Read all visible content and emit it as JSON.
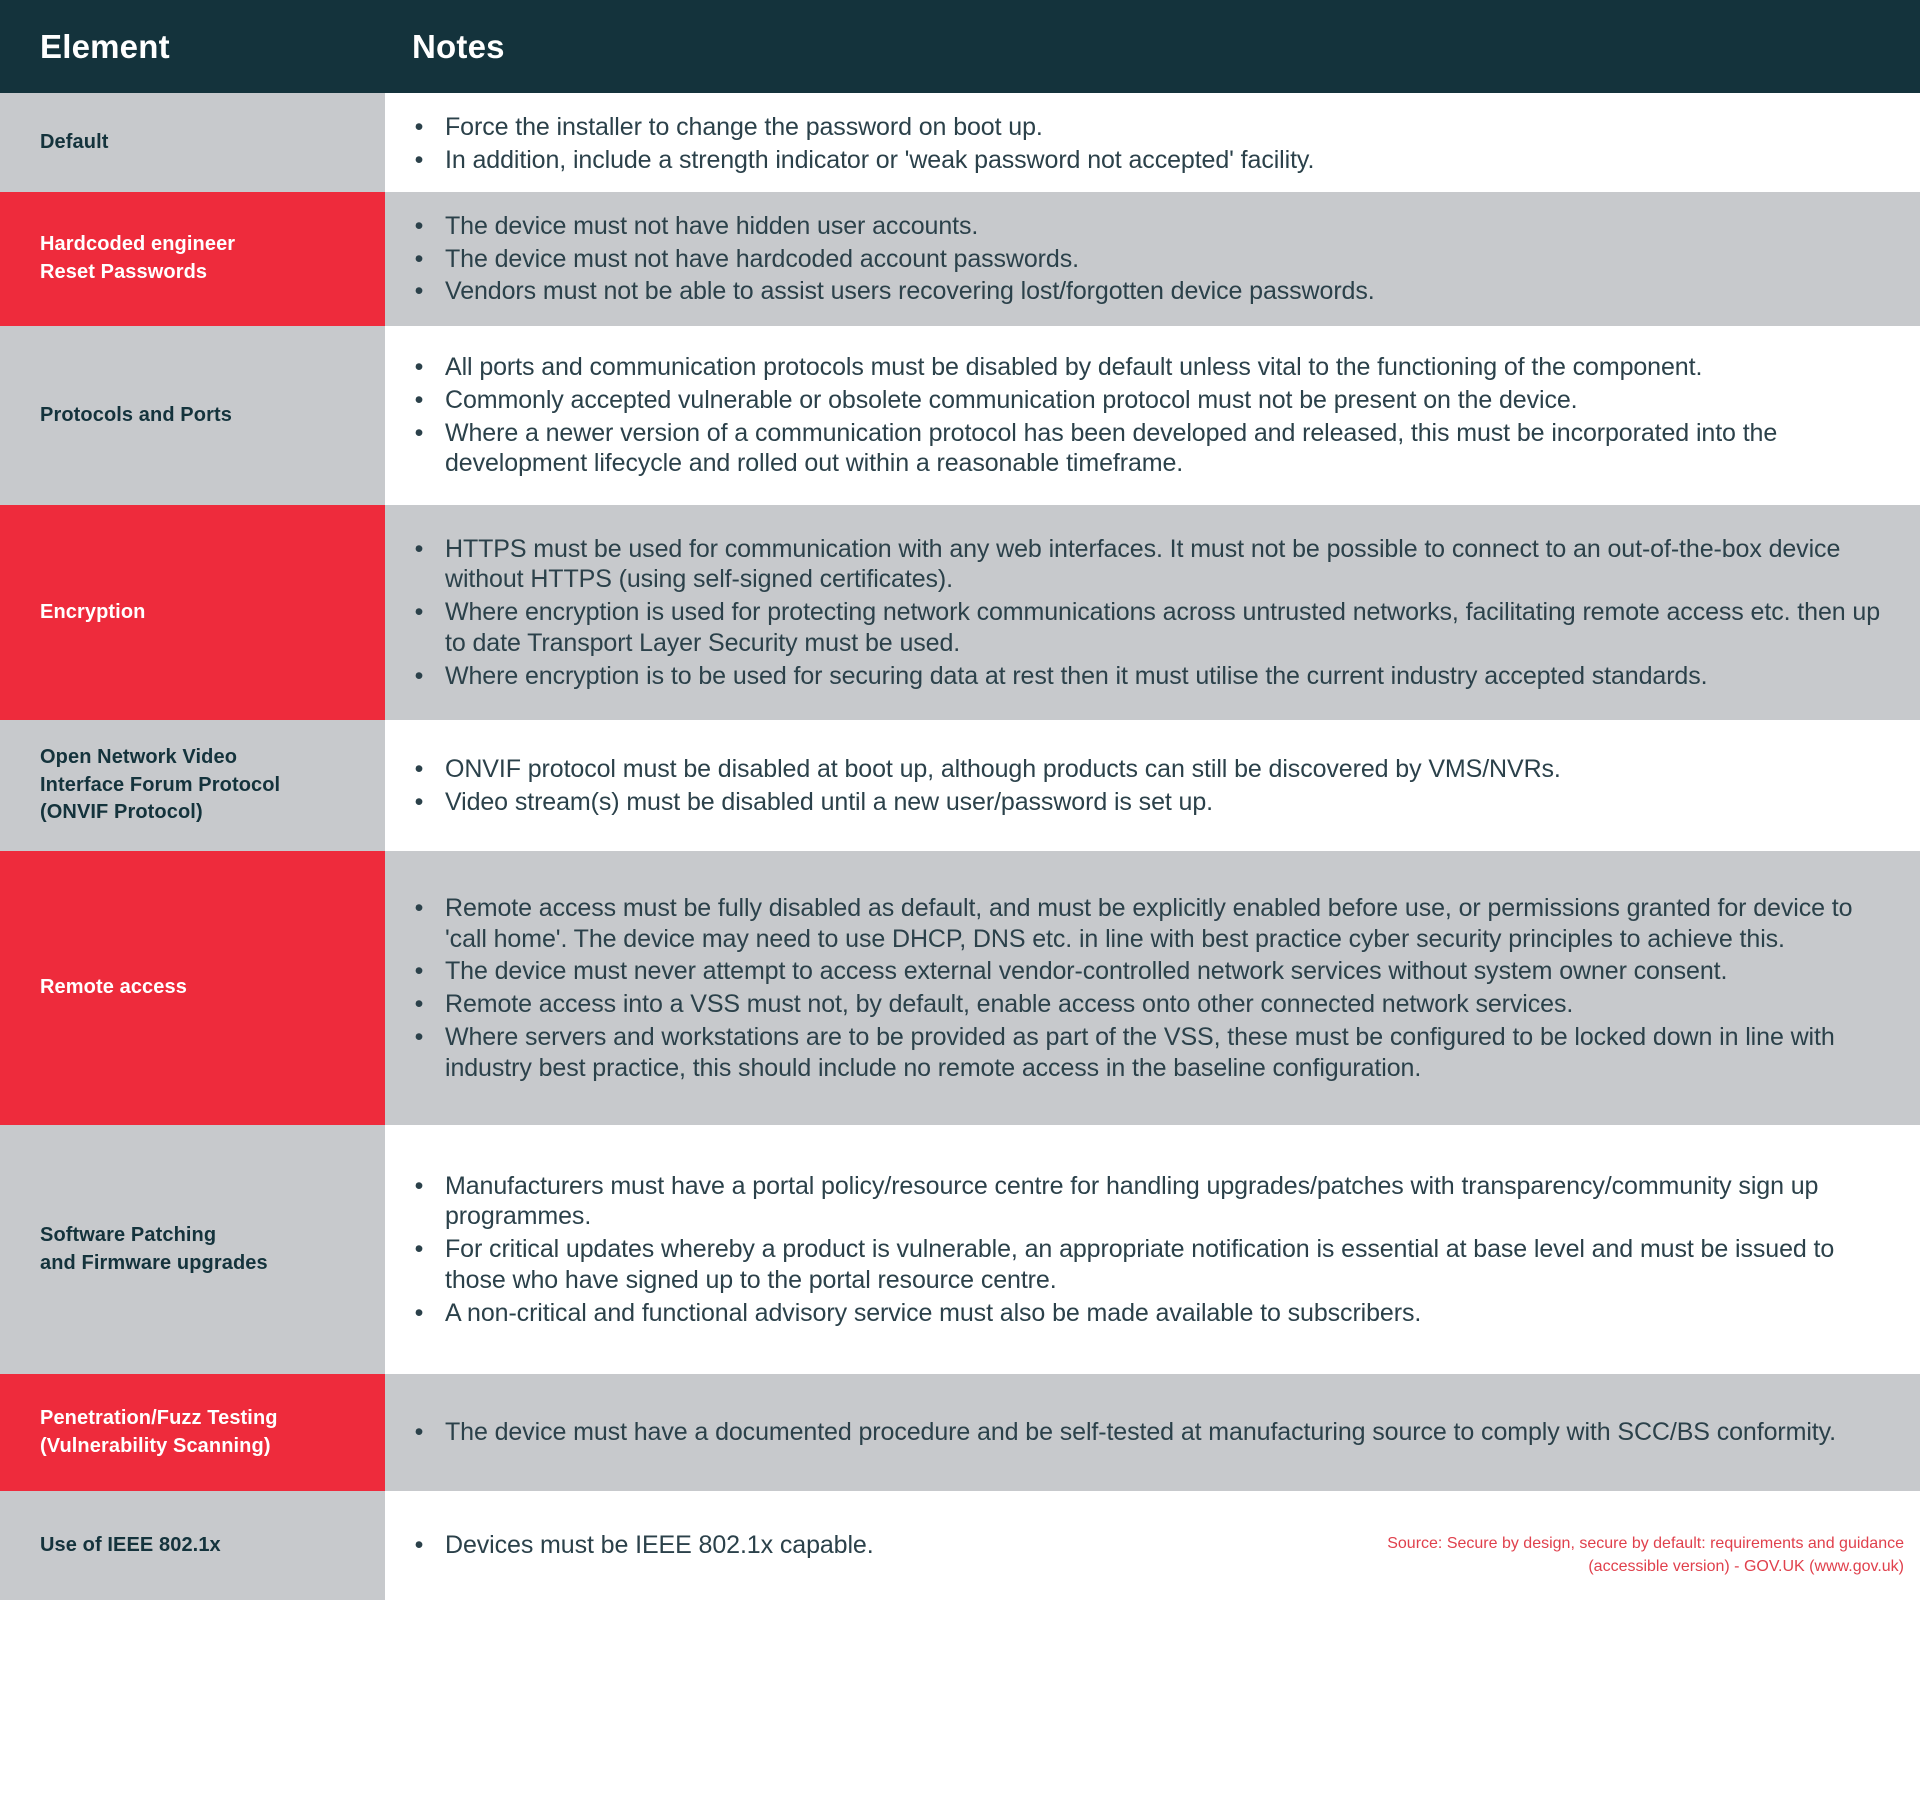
{
  "header": {
    "element_label": "Element",
    "notes_label": "Notes"
  },
  "colors": {
    "header_bg": "#14333c",
    "accent_red": "#ee2b3c",
    "row_grey": "#c7c9cc",
    "row_white": "#ffffff",
    "text_dark": "#2b414a",
    "source_red": "#e0404c"
  },
  "rows": [
    {
      "element": "Default",
      "element_bg": "grey",
      "notes_bg": "white",
      "notes": [
        "Force the installer to change the password on boot up.",
        "In addition, include a strength indicator or 'weak password not accepted' facility."
      ]
    },
    {
      "element": "Hardcoded engineer\nReset Passwords",
      "element_bg": "red",
      "notes_bg": "grey",
      "notes": [
        "The device must not have hidden user accounts.",
        "The device must not have hardcoded account passwords.",
        "Vendors must not be able to assist users recovering lost/forgotten device passwords."
      ]
    },
    {
      "element": "Protocols and Ports",
      "element_bg": "grey",
      "notes_bg": "white",
      "notes": [
        "All ports and communication protocols must be disabled by default unless vital to the functioning of the component.",
        "Commonly accepted vulnerable or obsolete communication protocol must not be present on the device.",
        "Where a newer version of a communication protocol has been developed and released, this must be incorporated into the development lifecycle and rolled out within a reasonable timeframe."
      ]
    },
    {
      "element": "Encryption",
      "element_bg": "red",
      "notes_bg": "grey",
      "notes": [
        "HTTPS must be used for communication with any web interfaces. It must not be possible to connect to an out-of-the-box device without HTTPS (using self-signed certificates).",
        "Where encryption is used for protecting network communications across untrusted networks, facilitating remote access etc. then up to date Transport Layer Security must be used.",
        "Where encryption is to be used for securing data at rest then it must utilise the current industry accepted standards."
      ]
    },
    {
      "element": "Open Network Video\nInterface Forum Protocol\n(ONVIF Protocol)",
      "element_bg": "grey",
      "notes_bg": "white",
      "notes": [
        "ONVIF protocol must be disabled at boot up, although products can still be discovered by VMS/NVRs.",
        "Video stream(s) must be disabled until a new user/password is set up."
      ]
    },
    {
      "element": "Remote access",
      "element_bg": "red",
      "notes_bg": "grey",
      "notes": [
        "Remote access must be fully disabled as default, and must be explicitly enabled before use, or permissions granted for device to 'call home'. The device may need to use DHCP, DNS etc. in line with best practice cyber security principles to achieve this.",
        "The device must never attempt to access external vendor-controlled network services without system owner consent.",
        "Remote access into a VSS must not, by default, enable access onto other connected network services.",
        "Where servers and workstations are to be provided as part of the VSS, these must be configured to be locked down in line with industry best practice, this should include no remote access in the baseline configuration."
      ]
    },
    {
      "element": "Software Patching\nand Firmware upgrades",
      "element_bg": "grey",
      "notes_bg": "white",
      "notes": [
        "Manufacturers must have a portal policy/resource centre for handling upgrades/patches with transparency/community sign up programmes.",
        "For critical updates whereby a product is vulnerable, an appropriate notification is essential at base level and must be issued to those who have signed up to the portal resource centre.",
        "A non-critical and functional advisory service must also be made available to subscribers."
      ]
    },
    {
      "element": "Penetration/Fuzz Testing\n(Vulnerability Scanning)",
      "element_bg": "red",
      "notes_bg": "grey",
      "notes": [
        "The device must have a documented procedure and be self-tested at manufacturing source to comply with SCC/BS conformity."
      ]
    },
    {
      "element": "Use of IEEE 802.1x",
      "element_bg": "grey",
      "notes_bg": "white",
      "notes": [
        "Devices must be IEEE 802.1x capable."
      ]
    }
  ],
  "source": "Source: Secure by design, secure by default: requirements and guidance (accessible version) - GOV.UK (www.gov.uk)"
}
